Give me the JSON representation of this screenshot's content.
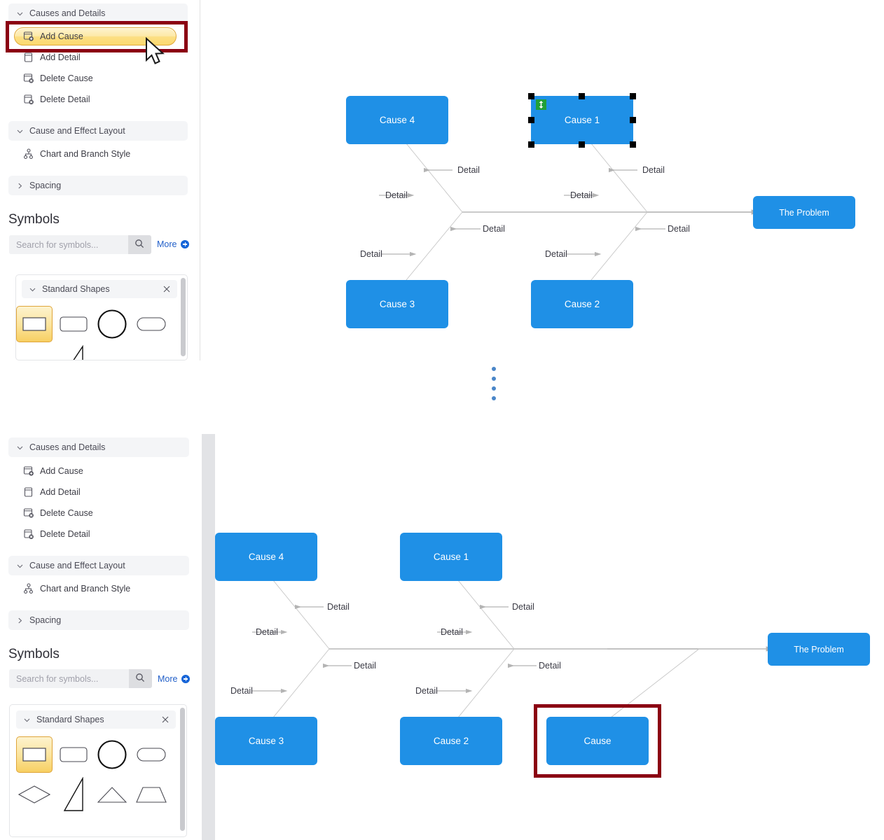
{
  "accent": {
    "node_blue": "#1f90e6",
    "highlight_red": "#8b0012",
    "pill_gold": "#fbd96f",
    "link_blue": "#2360c9",
    "badge_green": "#21a038",
    "connector_gray": "#b9b9b9"
  },
  "panel": {
    "groups": [
      {
        "label": "Causes and Details",
        "expanded": true,
        "chevron": "chevron-down-icon"
      },
      {
        "label": "Cause and Effect Layout",
        "expanded": true,
        "chevron": "chevron-down-icon"
      },
      {
        "label": "Spacing",
        "expanded": false,
        "chevron": "chevron-right-icon"
      }
    ],
    "causes_and_details_items": [
      {
        "label": "Add Cause",
        "icon": "add-cause-icon"
      },
      {
        "label": "Add Detail",
        "icon": "add-detail-icon"
      },
      {
        "label": "Delete Cause",
        "icon": "delete-cause-icon"
      },
      {
        "label": "Delete Detail",
        "icon": "delete-detail-icon"
      }
    ],
    "layout_items": [
      {
        "label": "Chart and Branch Style",
        "icon": "chart-branch-style-icon"
      }
    ],
    "symbols": {
      "title": "Symbols",
      "search_placeholder": "Search for symbols...",
      "search_value": "",
      "search_icon": "search-icon",
      "more_label": "More",
      "more_icon": "plus-circle-icon",
      "shape_group": {
        "label": "Standard Shapes",
        "expanded": true,
        "chevron": "chevron-down-icon",
        "close_icon": "close-icon"
      },
      "shapes_row1": [
        {
          "name": "rectangle-shape",
          "selected": true
        },
        {
          "name": "rounded-rectangle-shape",
          "selected": false
        },
        {
          "name": "circle-shape",
          "selected": false
        },
        {
          "name": "stadium-shape",
          "selected": false
        }
      ],
      "shapes_row2": [
        {
          "name": "diamond-shape",
          "selected": false
        },
        {
          "name": "right-triangle-shape",
          "selected": false
        },
        {
          "name": "triangle-shape",
          "selected": false
        },
        {
          "name": "trapezoid-shape",
          "selected": false
        }
      ]
    }
  },
  "diagram_top": {
    "problem_label": "The Problem",
    "causes": [
      {
        "label": "Cause 4",
        "position": "upper-left",
        "selected": false
      },
      {
        "label": "Cause 1",
        "position": "upper-right",
        "selected": true,
        "badge_icon": "vertical-resize-icon"
      },
      {
        "label": "Cause 3",
        "position": "lower-left",
        "selected": false
      },
      {
        "label": "Cause 2",
        "position": "lower-right",
        "selected": false
      }
    ],
    "detail_label": "Detail",
    "detail_count": 8,
    "cursor_icon": "mouse-pointer-icon"
  },
  "diagram_bottom": {
    "problem_label": "The Problem",
    "causes": [
      {
        "label": "Cause 4",
        "position": "upper-left",
        "highlighted": false
      },
      {
        "label": "Cause 1",
        "position": "upper-middle",
        "highlighted": false
      },
      {
        "label": "Cause 3",
        "position": "lower-left",
        "highlighted": false
      },
      {
        "label": "Cause 2",
        "position": "lower-middle",
        "highlighted": false
      },
      {
        "label": "Cause",
        "position": "lower-right-new",
        "highlighted": true
      }
    ],
    "detail_label": "Detail",
    "detail_count": 8
  },
  "separator": {
    "name": "vertical-ellipsis-separator",
    "dot_count": 4
  }
}
